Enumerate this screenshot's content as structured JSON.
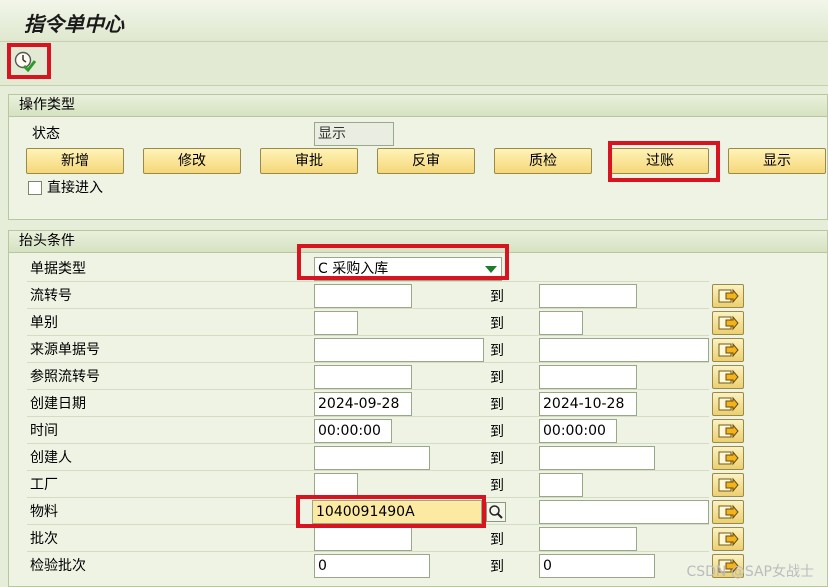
{
  "title": "指令单中心",
  "toolbar": {
    "execute_icon": "execute-check-icon"
  },
  "operation_group": {
    "header": "操作类型",
    "status_label": "状态",
    "status_value": "显示",
    "buttons": {
      "new": "新增",
      "modify": "修改",
      "approve": "审批",
      "reverse": "反审",
      "inspect": "质检",
      "post": "过账",
      "display": "显示"
    },
    "direct_entry_label": "直接进入",
    "direct_entry_checked": false
  },
  "header_group": {
    "header": "抬头条件",
    "doc_type_label": "单据类型",
    "doc_type_value": "C 采购入库",
    "to_label": "到",
    "rows": [
      {
        "label": "流转号",
        "from": "",
        "to": ""
      },
      {
        "label": "单别",
        "from": "",
        "to": ""
      },
      {
        "label": "来源单据号",
        "from": "",
        "to": ""
      },
      {
        "label": "参照流转号",
        "from": "",
        "to": ""
      },
      {
        "label": "创建日期",
        "from": "2024-09-28",
        "to": "2024-10-28"
      },
      {
        "label": "时间",
        "from": "00:00:00",
        "to": "00:00:00"
      },
      {
        "label": "创建人",
        "from": "",
        "to": ""
      },
      {
        "label": "工厂",
        "from": "",
        "to": ""
      },
      {
        "label": "物料",
        "from": "1040091490A",
        "to": ""
      },
      {
        "label": "批次",
        "from": "",
        "to": ""
      },
      {
        "label": "检验批次",
        "from": "0",
        "to": "0"
      }
    ]
  },
  "watermark": "CSDN @SAP女战士",
  "colors": {
    "highlight_border": "#d7141f",
    "button_fill": "#f5d779",
    "material_field_fill": "#fdeaa2"
  }
}
